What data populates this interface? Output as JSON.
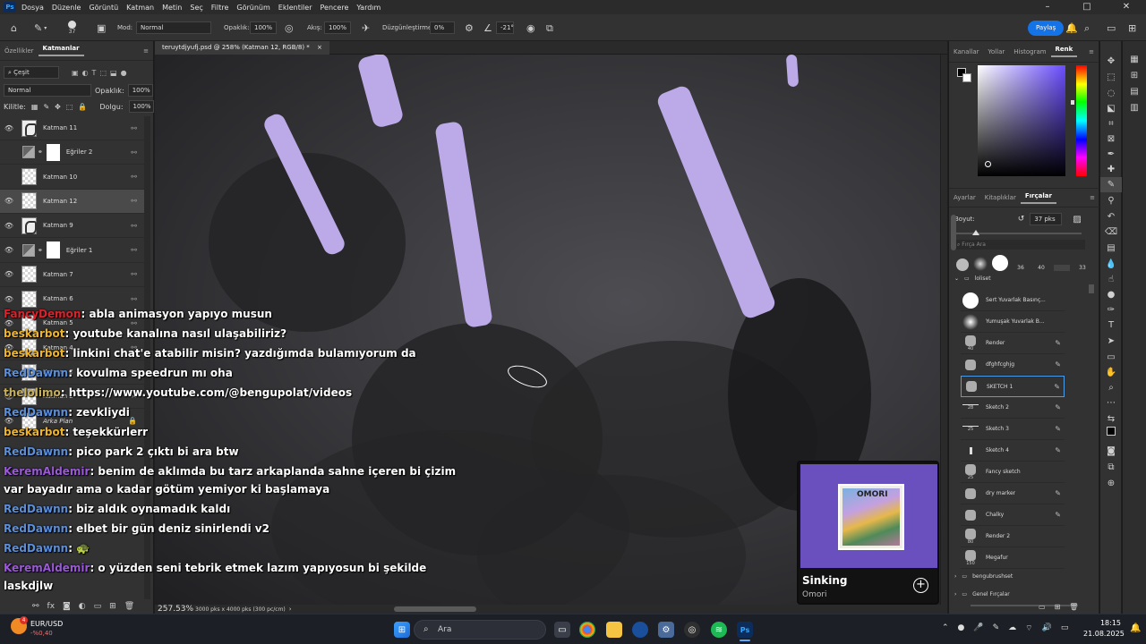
{
  "menu": {
    "logo": "Ps",
    "items": [
      "Dosya",
      "Düzenle",
      "Görüntü",
      "Katman",
      "Metin",
      "Seç",
      "Filtre",
      "Görünüm",
      "Eklentiler",
      "Pencere",
      "Yardım"
    ]
  },
  "options": {
    "brush_size": "37",
    "mode_label": "Mod:",
    "mode_value": "Normal",
    "opacity_label": "Opaklık:",
    "opacity_value": "100%",
    "flow_label": "Akış:",
    "flow_value": "100%",
    "smoothing_label": "Düzgünleştirme:",
    "smoothing_value": "0%",
    "angle_value": "-21°",
    "share": "Paylaş"
  },
  "layers_panel": {
    "tabs": [
      "Özellikler",
      "Katmanlar"
    ],
    "filter": "Çeşit",
    "blend": "Normal",
    "opacity_label": "Opaklık:",
    "opacity": "100%",
    "lock_label": "Kilitle:",
    "fill_label": "Dolgu:",
    "fill": "100%",
    "layers": [
      "Katman 11",
      "Eğriler 2",
      "Katman 10",
      "Katman 12",
      "Katman 9",
      "Eğriler 1",
      "Katman 7",
      "Katman 6",
      "Katman 5",
      "Katman 4",
      "Katman 3",
      "Katman 2",
      "Arka Plan"
    ]
  },
  "document": {
    "tab": "teruytdjyufj.psd @ 258% (Katman 12, RGB/8) *",
    "zoom": "257.53%",
    "size": "3000 pks x 4000 pks (300 pc/cm)"
  },
  "color_panel": {
    "tabs": [
      "Kanallar",
      "Yollar",
      "Histogram",
      "Renk"
    ]
  },
  "brush_panel": {
    "tabs": [
      "Ayarlar",
      "Kitaplıklar",
      "Fırçalar"
    ],
    "size_label": "Boyut:",
    "size_value": "37 pks",
    "search_placeholder": "Fırça Ara",
    "preset_sizes": [
      "36",
      "40",
      "33"
    ],
    "folder": "loliset",
    "brushes": [
      {
        "name": "Sert Yuvarlak Basınç...",
        "size": ""
      },
      {
        "name": "Yumuşak Yuvarlak B...",
        "size": ""
      },
      {
        "name": "Render",
        "size": "40"
      },
      {
        "name": "dfghfcghjg",
        "size": ""
      },
      {
        "name": "SKETCH 1",
        "size": ""
      },
      {
        "name": "Sketch 2",
        "size": "28"
      },
      {
        "name": "Sketch 3",
        "size": "25"
      },
      {
        "name": "Sketch 4",
        "size": ""
      },
      {
        "name": "Fancy sketch",
        "size": "25"
      },
      {
        "name": "dry marker",
        "size": ""
      },
      {
        "name": "Chalky",
        "size": ""
      },
      {
        "name": "Render 2",
        "size": "80"
      },
      {
        "name": "Megafur",
        "size": "150"
      }
    ],
    "groups": [
      "bengubrushset",
      "Genel Fırçalar"
    ]
  },
  "chat": [
    {
      "user": "FancyDemon",
      "color": "#e0202a",
      "text": ": abla animasyon yapıyo musun"
    },
    {
      "user": "beskarbot",
      "color": "#f0b429",
      "text": ": youtube kanalına nasıl ulaşabiliriz?"
    },
    {
      "user": "beskarbot",
      "color": "#f0b429",
      "text": ": linkini chat'e atabilir misin? yazdığımda bulamıyorum da"
    },
    {
      "user": "RedDawnn",
      "color": "#5b8fd9",
      "text": ": kovulma speedrun mı oha"
    },
    {
      "user": "thelolimo",
      "color": "#c8b05a",
      "text": ": https://www.youtube.com/@bengupolat/videos"
    },
    {
      "user": "RedDawnn",
      "color": "#5b8fd9",
      "text": ": zevkliydi"
    },
    {
      "user": "beskarbot",
      "color": "#f0b429",
      "text": ": teşekkürlerr"
    },
    {
      "user": "RedDawnn",
      "color": "#5b8fd9",
      "text": ": pico park 2 çıktı bi ara btw"
    },
    {
      "user": "KeremAldemir",
      "color": "#9b59d9",
      "text": ": benim de aklımda bu tarz arkaplanda sahne içeren bi çizim"
    },
    {
      "user": "",
      "color": "#ffffff",
      "text": "var bayadır ama o kadar götüm yemiyor ki başlamaya"
    },
    {
      "user": "RedDawnn",
      "color": "#5b8fd9",
      "text": ": biz aldık oynamadık kaldı"
    },
    {
      "user": "RedDawnn",
      "color": "#5b8fd9",
      "text": ": elbet bir gün deniz sinirlendi v2"
    },
    {
      "user": "RedDawnn",
      "color": "#5b8fd9",
      "text": ":"
    },
    {
      "user": "KeremAldemir",
      "color": "#9b59d9",
      "text": ": o yüzden seni tebrik etmek lazım yapıyosun bi şekilde"
    },
    {
      "user": "",
      "color": "#ffffff",
      "text": "laskdjlw"
    }
  ],
  "media": {
    "title": "Sinking",
    "artist": "Omori",
    "cover_text": "OMORI"
  },
  "taskbar": {
    "ticker_name": "EUR/USD",
    "ticker_change": "-%0,40",
    "badge": "4",
    "search": "Ara",
    "time": "18:15",
    "date": "21.08.2025"
  },
  "colors": {
    "accent": "#1473e6",
    "stroke": "#bca9e8",
    "media_bg": "#6a4fbf"
  }
}
